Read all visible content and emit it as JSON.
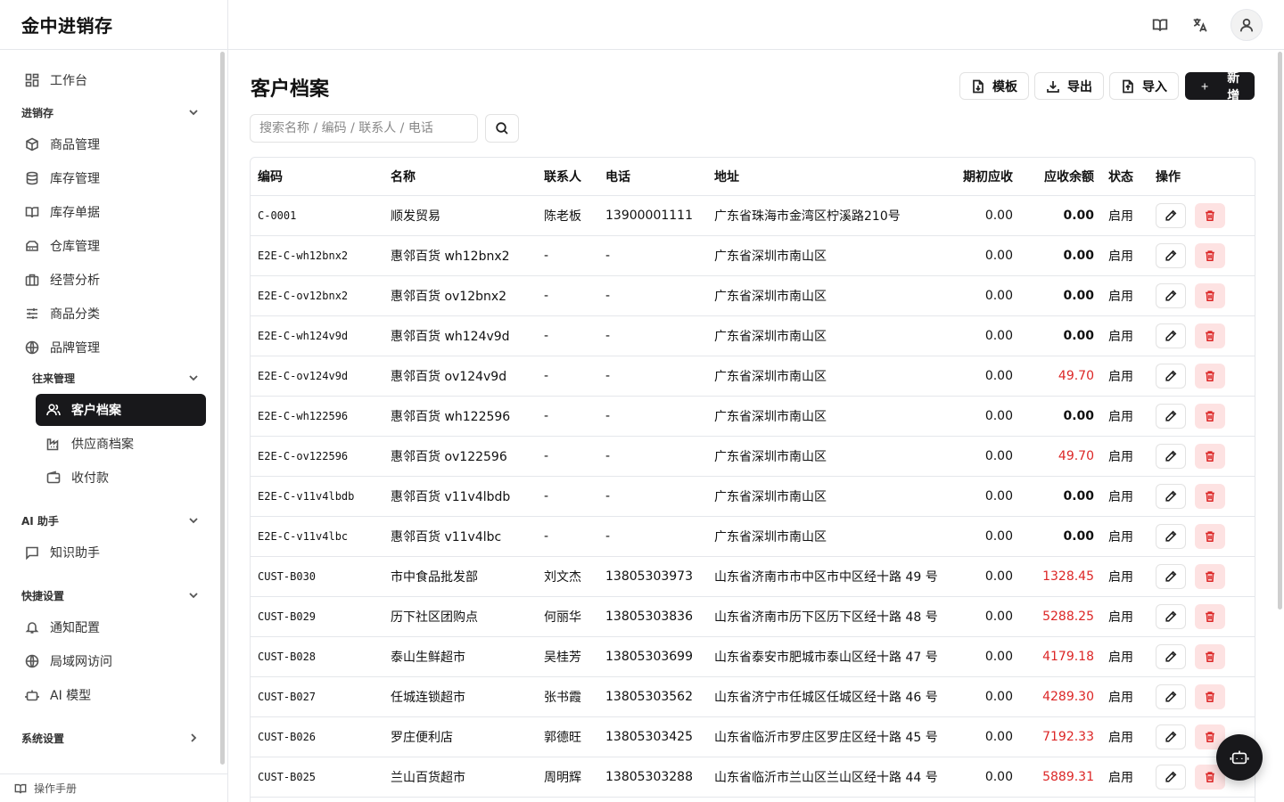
{
  "app": {
    "brand": "金中进销存"
  },
  "sidebar": {
    "workbench": "工作台",
    "groups": {
      "inventory": "进销存",
      "partners": "往来管理",
      "ai": "AI 助手",
      "quick": "快捷设置",
      "system": "系统设置"
    },
    "inventory_items": [
      "商品管理",
      "库存管理",
      "库存单据",
      "仓库管理",
      "经营分析",
      "商品分类",
      "品牌管理"
    ],
    "partner_items": [
      "客户档案",
      "供应商档案",
      "收付款"
    ],
    "ai_items": [
      "知识助手"
    ],
    "quick_items": [
      "通知配置",
      "局域网访问",
      "AI 模型"
    ],
    "footer": "操作手册"
  },
  "page": {
    "title": "客户档案",
    "buttons": {
      "template": "模板",
      "export": "导出",
      "import": "导入",
      "add": "新增"
    },
    "search_placeholder": "搜索名称 / 编码 / 联系人 / 电话"
  },
  "table": {
    "columns": [
      "编码",
      "名称",
      "联系人",
      "电话",
      "地址",
      "期初应收",
      "应收余额",
      "状态",
      "操作"
    ],
    "rows": [
      [
        "C-0001",
        "顺发贸易",
        "陈老板",
        "13900001111",
        "广东省珠海市金湾区柠溪路210号",
        "0.00",
        "0.00",
        "启用"
      ],
      [
        "E2E-C-wh12bnx2",
        "惠邻百货 wh12bnx2",
        "-",
        "-",
        "广东省深圳市南山区",
        "0.00",
        "0.00",
        "启用"
      ],
      [
        "E2E-C-ov12bnx2",
        "惠邻百货 ov12bnx2",
        "-",
        "-",
        "广东省深圳市南山区",
        "0.00",
        "0.00",
        "启用"
      ],
      [
        "E2E-C-wh124v9d",
        "惠邻百货 wh124v9d",
        "-",
        "-",
        "广东省深圳市南山区",
        "0.00",
        "0.00",
        "启用"
      ],
      [
        "E2E-C-ov124v9d",
        "惠邻百货 ov124v9d",
        "-",
        "-",
        "广东省深圳市南山区",
        "0.00",
        "49.70",
        "启用"
      ],
      [
        "E2E-C-wh122596",
        "惠邻百货 wh122596",
        "-",
        "-",
        "广东省深圳市南山区",
        "0.00",
        "0.00",
        "启用"
      ],
      [
        "E2E-C-ov122596",
        "惠邻百货 ov122596",
        "-",
        "-",
        "广东省深圳市南山区",
        "0.00",
        "49.70",
        "启用"
      ],
      [
        "E2E-C-v11v4lbdb",
        "惠邻百货 v11v4lbdb",
        "-",
        "-",
        "广东省深圳市南山区",
        "0.00",
        "0.00",
        "启用"
      ],
      [
        "E2E-C-v11v4lbc",
        "惠邻百货 v11v4lbc",
        "-",
        "-",
        "广东省深圳市南山区",
        "0.00",
        "0.00",
        "启用"
      ],
      [
        "CUST-B030",
        "市中食品批发部",
        "刘文杰",
        "13805303973",
        "山东省济南市市中区市中区经十路 49 号",
        "0.00",
        "1328.45",
        "启用"
      ],
      [
        "CUST-B029",
        "历下社区团购点",
        "何丽华",
        "13805303836",
        "山东省济南市历下区历下区经十路 48 号",
        "0.00",
        "5288.25",
        "启用"
      ],
      [
        "CUST-B028",
        "泰山生鲜超市",
        "吴桂芳",
        "13805303699",
        "山东省泰安市肥城市泰山区经十路 47 号",
        "0.00",
        "4179.18",
        "启用"
      ],
      [
        "CUST-B027",
        "任城连锁超市",
        "张书霞",
        "13805303562",
        "山东省济宁市任城区任城区经十路 46 号",
        "0.00",
        "4289.30",
        "启用"
      ],
      [
        "CUST-B026",
        "罗庄便利店",
        "郭德旺",
        "13805303425",
        "山东省临沂市罗庄区罗庄区经十路 45 号",
        "0.00",
        "7192.33",
        "启用"
      ],
      [
        "CUST-B025",
        "兰山百货超市",
        "周明辉",
        "13805303288",
        "山东省临沂市兰山区兰山区经十路 44 号",
        "0.00",
        "5889.31",
        "启用"
      ]
    ]
  },
  "colors": {
    "accent": "#18181b",
    "danger": "#dc2626",
    "danger_bg": "#fde2e2",
    "border": "#e5e7eb"
  }
}
